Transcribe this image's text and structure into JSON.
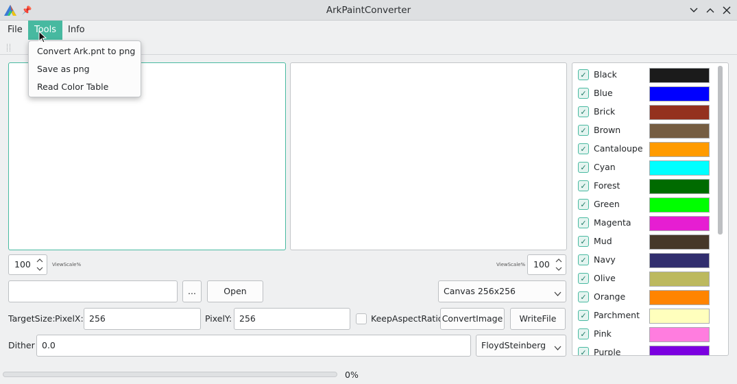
{
  "window": {
    "title": "ArkPaintConverter"
  },
  "menu": {
    "file": "File",
    "tools": "Tools",
    "info": "Info"
  },
  "tools_menu": {
    "items": [
      "Convert Ark.pnt to png",
      "Save as png",
      "Read Color Table"
    ]
  },
  "left_view": {
    "scale": "100",
    "scale_label": "ViewScale%"
  },
  "right_view": {
    "scale": "100",
    "scale_label": "ViewScale%"
  },
  "file_row": {
    "path_value": "",
    "browse_label": "...",
    "open_label": "Open",
    "canvas_selected": "Canvas 256x256"
  },
  "target_row": {
    "target_label": "TargetSize:",
    "pixelx_label": "PixelX:",
    "pixelx_value": "256",
    "pixely_label": "PixelY:",
    "pixely_value": "256",
    "keep_aspect_label": "KeepAspectRatio",
    "keep_aspect_checked": false,
    "convert_label": "ConvertImage",
    "write_label": "WriteFile"
  },
  "dither_row": {
    "label": "Dither",
    "value": "0.0",
    "method_selected": "FloydSteinberg"
  },
  "progress": {
    "value_text": "0%",
    "value": 0
  },
  "colors": [
    {
      "name": "Black",
      "hex": "#1b1b1b",
      "checked": true
    },
    {
      "name": "Blue",
      "hex": "#0000ff",
      "checked": true
    },
    {
      "name": "Brick",
      "hex": "#94311e",
      "checked": true
    },
    {
      "name": "Brown",
      "hex": "#755d42",
      "checked": true
    },
    {
      "name": "Cantaloupe",
      "hex": "#ff9b00",
      "checked": true
    },
    {
      "name": "Cyan",
      "hex": "#00ffff",
      "checked": true
    },
    {
      "name": "Forest",
      "hex": "#006b00",
      "checked": true
    },
    {
      "name": "Green",
      "hex": "#00ff00",
      "checked": true
    },
    {
      "name": "Magenta",
      "hex": "#e61ed2",
      "checked": true
    },
    {
      "name": "Mud",
      "hex": "#463829",
      "checked": true
    },
    {
      "name": "Navy",
      "hex": "#312e6e",
      "checked": true
    },
    {
      "name": "Olive",
      "hex": "#bcb95e",
      "checked": true
    },
    {
      "name": "Orange",
      "hex": "#ff8400",
      "checked": true
    },
    {
      "name": "Parchment",
      "hex": "#ffffbd",
      "checked": true
    },
    {
      "name": "Pink",
      "hex": "#ff7ddf",
      "checked": true
    },
    {
      "name": "Purple",
      "hex": "#7b00e0",
      "checked": true
    }
  ],
  "accent": "#47b9a0"
}
